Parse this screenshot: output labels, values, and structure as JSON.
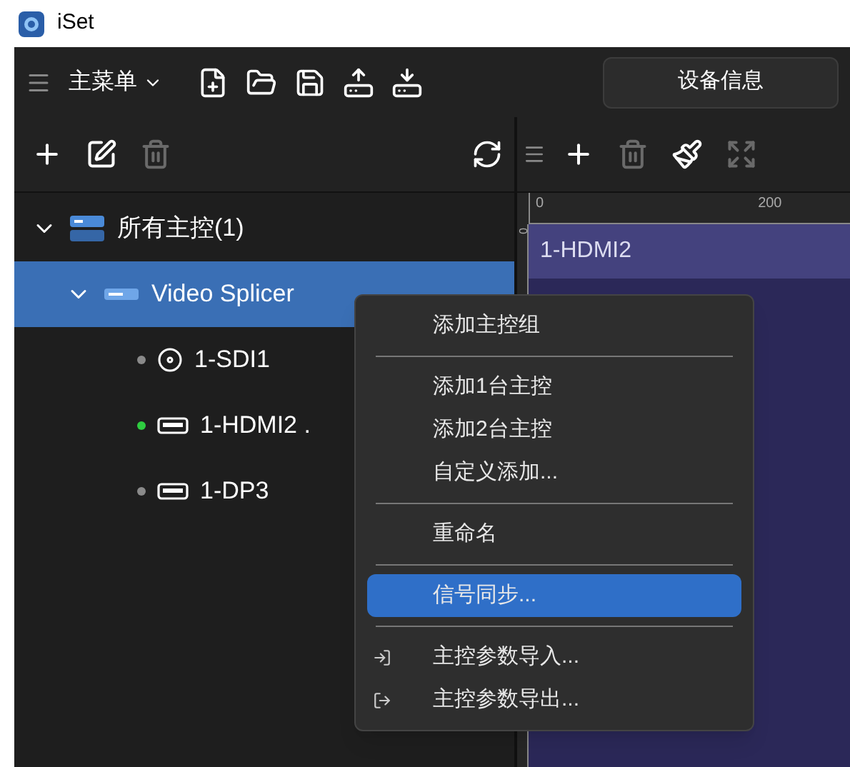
{
  "window": {
    "title": "iSet"
  },
  "toolbar": {
    "menu_label": "主菜单",
    "device_info_button": "设备信息"
  },
  "tree_tools": [
    {
      "kind": "add",
      "disabled": false
    },
    {
      "kind": "edit",
      "disabled": false
    },
    {
      "kind": "delete",
      "disabled": true
    }
  ],
  "canvas_tools": [
    {
      "kind": "add",
      "disabled": false
    },
    {
      "kind": "delete",
      "disabled": true
    },
    {
      "kind": "clear",
      "disabled": false
    },
    {
      "kind": "fit",
      "disabled": true
    }
  ],
  "tree": [
    {
      "label": "所有主控(1)",
      "kind": "group",
      "expanded": true,
      "selected": false,
      "children": [
        {
          "label": "Video Splicer",
          "kind": "device",
          "expanded": true,
          "selected": true,
          "children": [
            {
              "label": "1-SDI1",
              "kind": "sdi",
              "color": "#8a8a8a",
              "selected": false
            },
            {
              "label": "1-HDMI2 .",
              "kind": "hdmi",
              "color": "#2ecc40",
              "selected": false
            },
            {
              "label": "1-DP3",
              "kind": "dp",
              "color": "#8a8a8a",
              "selected": false
            }
          ]
        }
      ]
    }
  ],
  "canvas": {
    "ruler_labels": [
      "0",
      "200"
    ],
    "vertical_ruler_label": "0",
    "layer_label": "1-HDMI2"
  },
  "context_menu": [
    {
      "kind": "item",
      "label": "添加主控组",
      "selected": false
    },
    {
      "kind": "separator"
    },
    {
      "kind": "item",
      "label": "添加1台主控",
      "selected": false
    },
    {
      "kind": "item",
      "label": "添加2台主控",
      "selected": false
    },
    {
      "kind": "item",
      "label": "自定义添加...",
      "selected": false
    },
    {
      "kind": "separator"
    },
    {
      "kind": "item",
      "label": "重命名",
      "selected": false
    },
    {
      "kind": "separator"
    },
    {
      "kind": "item",
      "label": "信号同步...",
      "selected": true
    },
    {
      "kind": "separator"
    },
    {
      "kind": "import",
      "label": "主控参数导入...",
      "selected": false
    },
    {
      "kind": "export",
      "label": "主控参数导出...",
      "selected": false
    }
  ]
}
